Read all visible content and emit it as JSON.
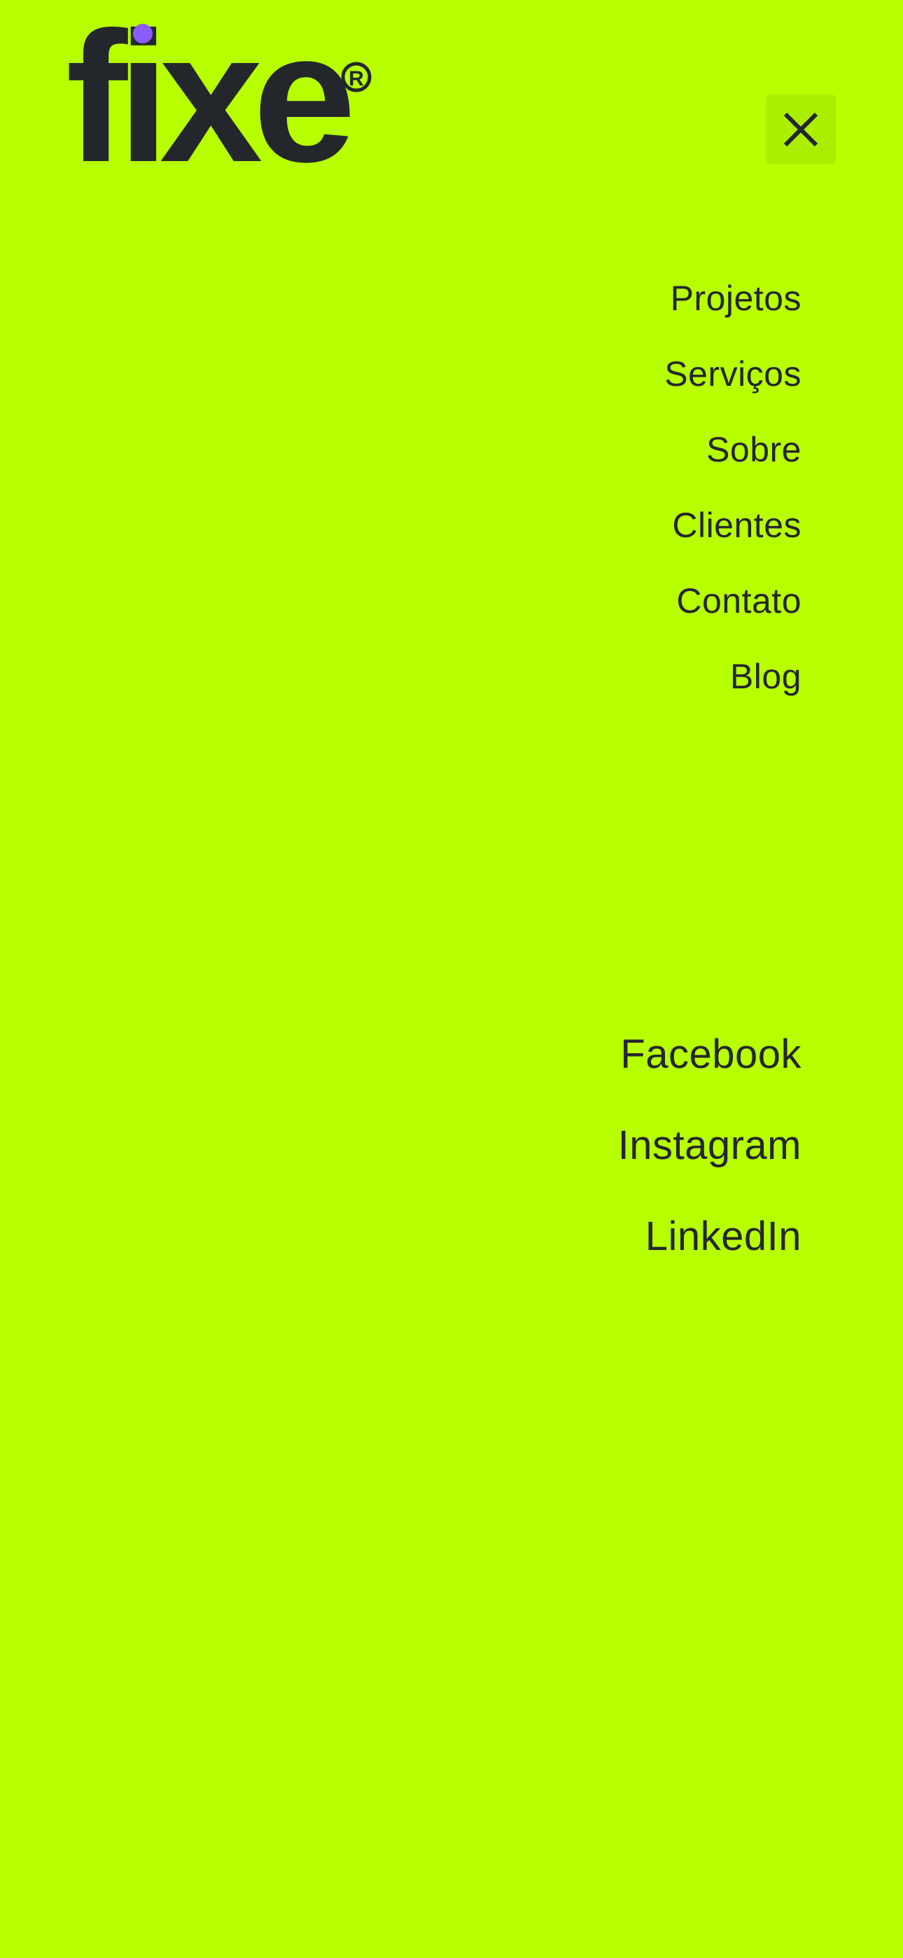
{
  "brand": {
    "logo_text": "fixe",
    "registered_mark": "®",
    "text_color": "#23272b",
    "dot_color": "#8a5cff",
    "background": "#b8ff00"
  },
  "header": {
    "close_icon": "close-icon"
  },
  "nav": {
    "items": [
      {
        "label": "Projetos"
      },
      {
        "label": "Serviços"
      },
      {
        "label": "Sobre"
      },
      {
        "label": "Clientes"
      },
      {
        "label": "Contato"
      },
      {
        "label": "Blog"
      }
    ]
  },
  "social": {
    "items": [
      {
        "label": "Facebook"
      },
      {
        "label": "Instagram"
      },
      {
        "label": "LinkedIn"
      }
    ]
  }
}
